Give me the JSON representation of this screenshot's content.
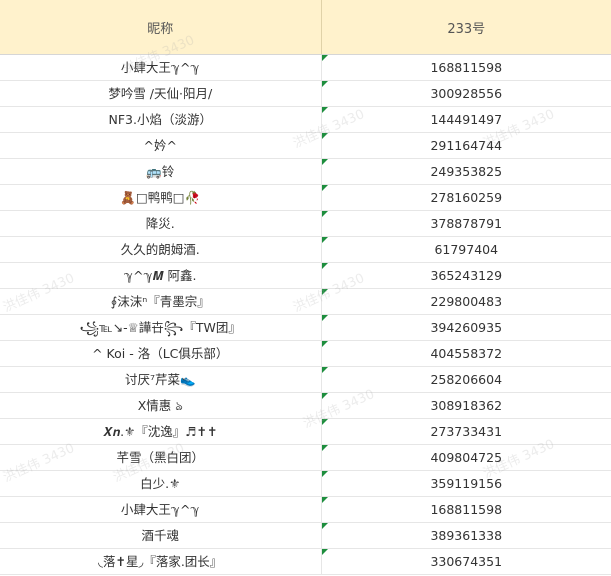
{
  "header": {
    "col_name": "昵称",
    "col_id": "233号"
  },
  "rows": [
    {
      "name": "小肆大王ℽ^ℽ",
      "id": "168811598"
    },
    {
      "name": "梦吟雪 /天仙·阳月/",
      "id": "300928556"
    },
    {
      "name": "NF3.小焰（淡游）",
      "id": "144491497"
    },
    {
      "name": "^妗^",
      "id": "291164744"
    },
    {
      "name": "🚌铃",
      "id": "249353825"
    },
    {
      "name": "🧸□鸭鸭□🥀",
      "id": "278160259"
    },
    {
      "name": "降災.",
      "id": "378878791"
    },
    {
      "name": "久久的朗姆酒.",
      "id": "61797404"
    },
    {
      "name": "ℽ^ℽ𝑴 阿鑫.",
      "id": "365243129"
    },
    {
      "name": "∮沫沫ⁿ『青墨宗』",
      "id": "229800483"
    },
    {
      "name": "꧁℡↘-♕譁卋꧂『TW团』",
      "id": "394260935"
    },
    {
      "name": "^ Koi - 洛（LC俱乐部）",
      "id": "404558372"
    },
    {
      "name": "讨厌⁷芹菜👟",
      "id": "258206604"
    },
    {
      "name": "Ⅹ情惠 ঌ",
      "id": "308918362"
    },
    {
      "name": "𝑿𝒏.⚜『沈逸』♬✝✝",
      "id": "273733431"
    },
    {
      "name": "芊雪（黑白团）",
      "id": "409804725"
    },
    {
      "name": "白少.⚜",
      "id": "359119156"
    },
    {
      "name": "小肆大王ℽ^ℽ",
      "id": "168811598"
    },
    {
      "name": "酒千魂",
      "id": "389361338"
    },
    {
      "name": "◟落✝星◞『落家.团长』",
      "id": "330674351"
    }
  ],
  "watermark": "洪佳伟 3430",
  "colors": {
    "header_bg": "#fff2cc",
    "flag": "#1e8e3e",
    "grid": "#e6e6e6"
  }
}
